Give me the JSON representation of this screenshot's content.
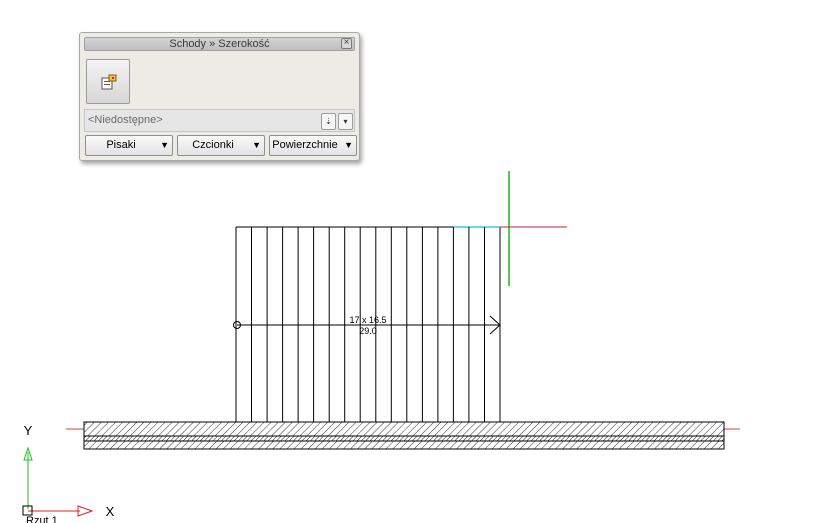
{
  "palette": {
    "title": "Schody » Szerokość",
    "status_text": "<Niedostępne>",
    "dropdowns": [
      "Pisaki",
      "Czcionki",
      "Powierzchnie"
    ],
    "icons": {
      "close": "close-icon",
      "settings": "stair-settings-icon",
      "toggle": "toggle-icon",
      "more": "chevron-down-icon",
      "dropdown_arrow": "caret-down-icon"
    }
  },
  "drawing": {
    "stair_label_top": "17 x 16.5",
    "stair_label_bottom": "29.0",
    "axis_y_label": "Y",
    "axis_x_label": "X",
    "view_label": "Rzut 1",
    "colors": {
      "cursor_vertical": "#18b81c",
      "cursor_horizontal": "#c2202e",
      "cyan_highlight": "#38c8e0",
      "axis_green": "#22c022",
      "axis_red": "#e02020"
    }
  }
}
